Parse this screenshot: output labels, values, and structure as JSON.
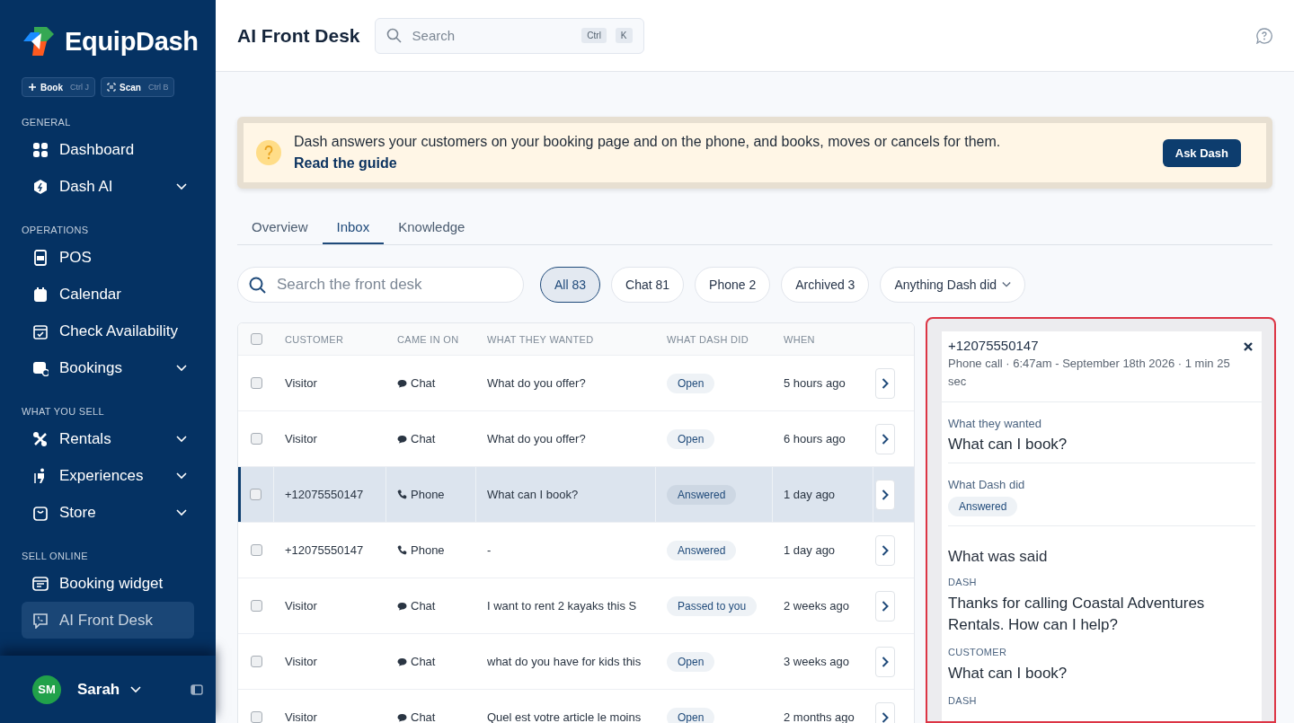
{
  "sidebar": {
    "brand": "EquipDash",
    "quick_actions": [
      {
        "label": "Book",
        "shortcut": "Ctrl J"
      },
      {
        "label": "Scan",
        "shortcut": "Ctrl B"
      }
    ],
    "sections": [
      {
        "heading": "GENERAL",
        "items": [
          {
            "label": "Dashboard",
            "has_submenu": false,
            "selected": false
          },
          {
            "label": "Dash AI",
            "has_submenu": true,
            "selected": false
          }
        ]
      },
      {
        "heading": "OPERATIONS",
        "items": [
          {
            "label": "POS",
            "has_submenu": false,
            "selected": false
          },
          {
            "label": "Calendar",
            "has_submenu": false,
            "selected": false
          },
          {
            "label": "Check Availability",
            "has_submenu": false,
            "selected": false
          },
          {
            "label": "Bookings",
            "has_submenu": true,
            "selected": false
          }
        ]
      },
      {
        "heading": "WHAT YOU SELL",
        "items": [
          {
            "label": "Rentals",
            "has_submenu": true,
            "selected": false
          },
          {
            "label": "Experiences",
            "has_submenu": true,
            "selected": false
          },
          {
            "label": "Store",
            "has_submenu": true,
            "selected": false
          }
        ]
      },
      {
        "heading": "SELL ONLINE",
        "items": [
          {
            "label": "Booking widget",
            "has_submenu": false,
            "selected": false
          },
          {
            "label": "AI Front Desk",
            "has_submenu": false,
            "selected": true
          }
        ]
      }
    ],
    "user": {
      "initials": "SM",
      "name": "Sarah"
    }
  },
  "header": {
    "title": "AI Front Desk",
    "search": {
      "placeholder": "Search",
      "keys": [
        "Ctrl",
        "K"
      ]
    }
  },
  "banner": {
    "text": "Dash answers your customers on your booking page and on the phone, and books, moves or cancels for them.",
    "link": "Read the guide",
    "button": "Ask Dash"
  },
  "tabs": [
    {
      "label": "Overview",
      "selected": false
    },
    {
      "label": "Inbox",
      "selected": true
    },
    {
      "label": "Knowledge",
      "selected": false
    }
  ],
  "filters": {
    "search": {
      "placeholder": "Search the front desk"
    },
    "chips": [
      {
        "label": "All 83",
        "selected": true
      },
      {
        "label": "Chat 81",
        "selected": false
      },
      {
        "label": "Phone 2",
        "selected": false
      },
      {
        "label": "Archived 3",
        "selected": false
      }
    ],
    "dropdown": "Anything Dash did"
  },
  "table": {
    "select_all": {
      "checked": false
    },
    "columns": [
      "CUSTOMER",
      "CAME IN ON",
      "WHAT THEY WANTED",
      "WHAT DASH DID",
      "WHEN"
    ],
    "rows": [
      {
        "customer": "Visitor",
        "channel": {
          "kind": "chat",
          "label": "Chat"
        },
        "wanted": "What do you offer?",
        "status": "Open",
        "when": "5 hours ago",
        "checked": false,
        "selected": false
      },
      {
        "customer": "Visitor",
        "channel": {
          "kind": "chat",
          "label": "Chat"
        },
        "wanted": "What do you offer?",
        "status": "Open",
        "when": "6 hours ago",
        "checked": false,
        "selected": false
      },
      {
        "customer": "+12075550147",
        "channel": {
          "kind": "phone",
          "label": "Phone"
        },
        "wanted": "What can I book?",
        "status": "Answered",
        "when": "1 day ago",
        "checked": false,
        "selected": true
      },
      {
        "customer": "+12075550147",
        "channel": {
          "kind": "phone",
          "label": "Phone"
        },
        "wanted": "-",
        "status": "Answered",
        "when": "1 day ago",
        "checked": false,
        "selected": false
      },
      {
        "customer": "Visitor",
        "channel": {
          "kind": "chat",
          "label": "Chat"
        },
        "wanted": "I want to rent 2 kayaks this S",
        "status": "Passed to you",
        "when": "2 weeks ago",
        "checked": false,
        "selected": false
      },
      {
        "customer": "Visitor",
        "channel": {
          "kind": "chat",
          "label": "Chat"
        },
        "wanted": "what do you have for kids this",
        "status": "Open",
        "when": "3 weeks ago",
        "checked": false,
        "selected": false
      },
      {
        "customer": "Visitor",
        "channel": {
          "kind": "chat",
          "label": "Chat"
        },
        "wanted": "Quel est votre article le moins",
        "status": "Open",
        "when": "2 months ago",
        "checked": false,
        "selected": false
      }
    ]
  },
  "detail": {
    "title": "+12075550147",
    "meta": "Phone call · 6:47am - September 18th 2026 · 1 min 25 sec",
    "wanted_label": "What they wanted",
    "wanted": "What can I book?",
    "did_label": "What Dash did",
    "did": "Answered",
    "transcript_heading": "What was said",
    "messages": [
      {
        "speaker": "DASH",
        "text": "Thanks for calling Coastal Adventures Rentals. How can I help?"
      },
      {
        "speaker": "CUSTOMER",
        "text": "What can I book?"
      },
      {
        "speaker": "DASH"
      }
    ]
  }
}
